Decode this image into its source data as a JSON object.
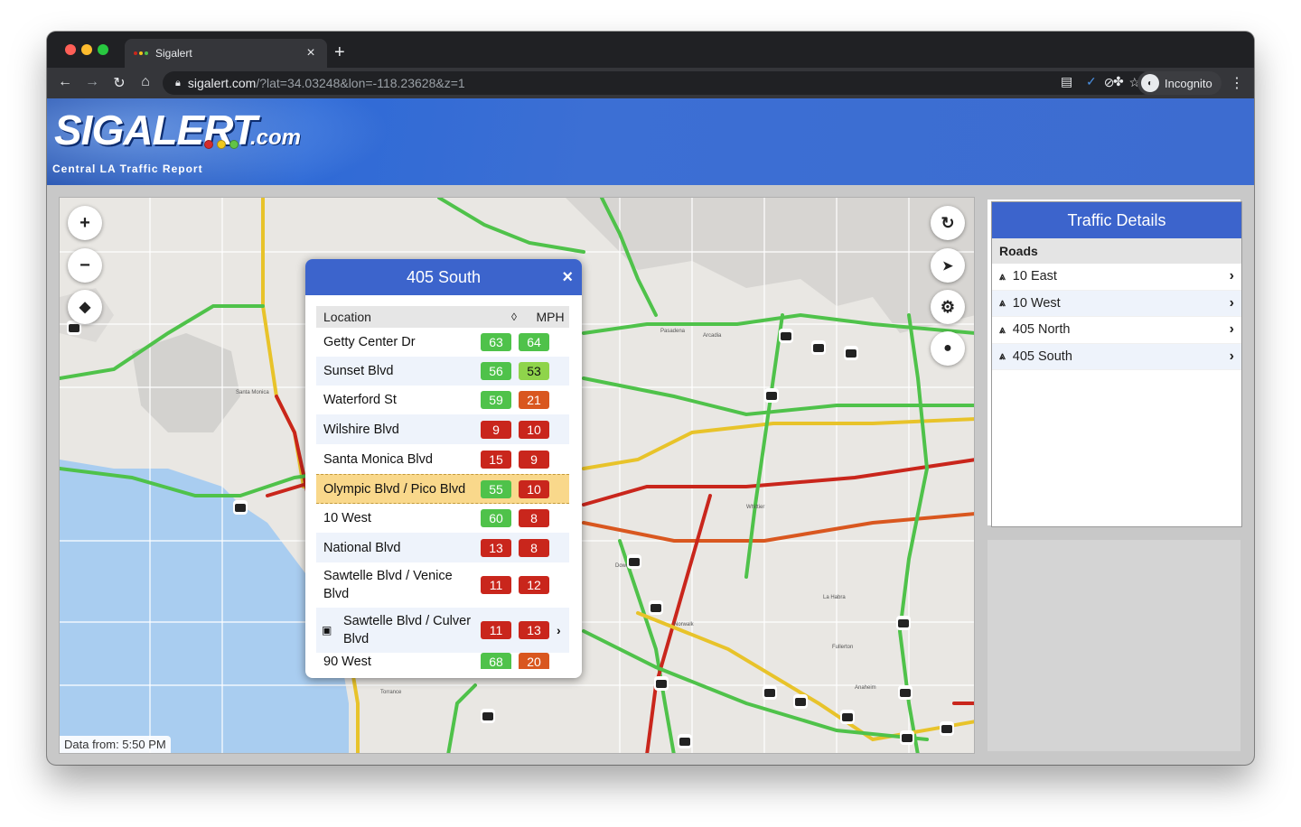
{
  "browser": {
    "tab_title": "Sigalert",
    "url_host": "sigalert.com",
    "url_rest": "/?lat=34.03248&lon=-118.23628&z=1",
    "profile": "Incognito"
  },
  "header": {
    "logo_main": "SIGALERT",
    "logo_com": ".com",
    "subtitle": "Central LA Traffic Report"
  },
  "map": {
    "data_from": "Data from: 5:50 PM"
  },
  "popup": {
    "title": "405 South",
    "close": "×",
    "col_location": "Location",
    "col_sort": "◊",
    "col_mph": "MPH",
    "rows": [
      {
        "loc": "Getty Center Dr",
        "a": "63",
        "b": "64"
      },
      {
        "loc": "Sunset Blvd",
        "a": "56",
        "b": "53"
      },
      {
        "loc": "Waterford St",
        "a": "59",
        "b": "21"
      },
      {
        "loc": "Wilshire Blvd",
        "a": "9",
        "b": "10"
      },
      {
        "loc": "Santa Monica Blvd",
        "a": "15",
        "b": "9"
      },
      {
        "loc": "Olympic Blvd / Pico Blvd",
        "a": "55",
        "b": "10"
      },
      {
        "loc": "10 West",
        "a": "60",
        "b": "8"
      },
      {
        "loc": "National Blvd",
        "a": "13",
        "b": "8"
      },
      {
        "loc": "Sawtelle Blvd / Venice Blvd",
        "a": "11",
        "b": "12"
      },
      {
        "loc": "Sawtelle Blvd / Culver Blvd",
        "a": "11",
        "b": "13"
      },
      {
        "loc": "90 West",
        "a": "68",
        "b": "20"
      }
    ]
  },
  "sidebar": {
    "title": "Traffic Details",
    "section": "Roads",
    "roads": [
      "10 East",
      "10 West",
      "405 North",
      "405 South"
    ]
  },
  "colors": {
    "accent": "#3c64cc",
    "fast": "#4fc24a",
    "slow": "#c9261c",
    "medium": "#d9571f"
  }
}
